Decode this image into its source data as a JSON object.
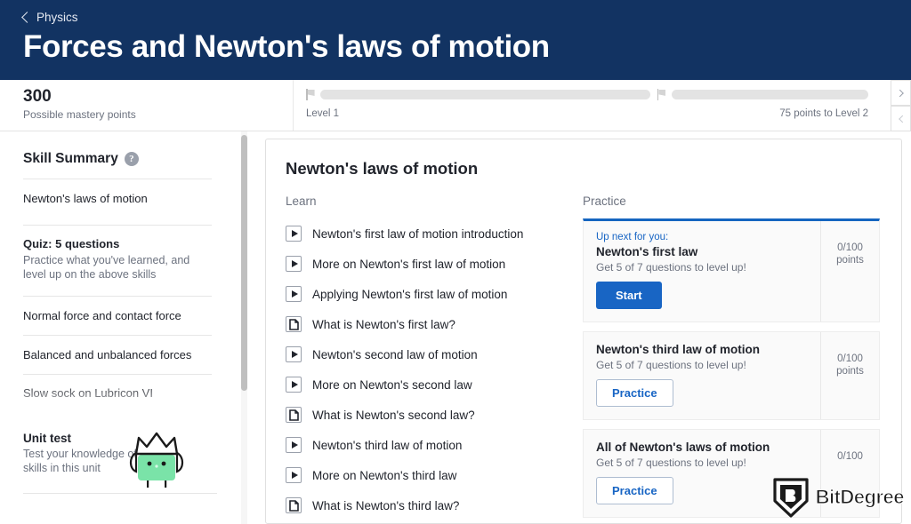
{
  "header": {
    "breadcrumb_label": "Physics",
    "back_icon": "chevron-left-icon",
    "title": "Forces and Newton's laws of motion",
    "bg_color": "#123362"
  },
  "mastery_bar": {
    "points": "300",
    "points_caption": "Possible mastery points",
    "level_label": "Level 1",
    "next_level_label": "75 points to Level 2",
    "flag_icon": "flag-icon",
    "next_icon": "chevron-right-icon",
    "prev_icon": "chevron-left-icon"
  },
  "sidebar": {
    "title": "Skill Summary",
    "help_icon": "question-mark-icon",
    "help_glyph": "?",
    "skill": {
      "name": "Newton's laws of motion",
      "mastery_icons": [
        "mastery-icon",
        "mastery-icon",
        "mastery-icon"
      ]
    },
    "quiz": {
      "title": "Quiz: 5 questions",
      "description": "Practice what you've learned, and level up on the above skills"
    },
    "items": [
      "Normal force and contact force",
      "Balanced and unbalanced forces",
      "Slow sock on Lubricon VI"
    ],
    "unit_test": {
      "title": "Unit test",
      "description": "Test your knowledge of all skills in this unit",
      "mascot_icon": "khan-mascot-crown-icon"
    }
  },
  "main": {
    "title": "Newton's laws of motion",
    "learn_heading": "Learn",
    "practice_heading": "Practice",
    "learn_items": [
      {
        "label": "Newton's first law of motion introduction",
        "type": "video",
        "icon": "play-icon"
      },
      {
        "label": "More on Newton's first law of motion",
        "type": "video",
        "icon": "play-icon"
      },
      {
        "label": "Applying Newton's first law of motion",
        "type": "video",
        "icon": "play-icon"
      },
      {
        "label": "What is Newton's first law?",
        "type": "article",
        "icon": "article-icon"
      },
      {
        "label": "Newton's second law of motion",
        "type": "video",
        "icon": "play-icon"
      },
      {
        "label": "More on Newton's second law",
        "type": "video",
        "icon": "play-icon"
      },
      {
        "label": "What is Newton's second law?",
        "type": "article",
        "icon": "article-icon"
      },
      {
        "label": "Newton's third law of motion",
        "type": "video",
        "icon": "play-icon"
      },
      {
        "label": "More on Newton's third law",
        "type": "video",
        "icon": "play-icon"
      },
      {
        "label": "What is Newton's third law?",
        "type": "article",
        "icon": "article-icon"
      }
    ],
    "practice_cards": [
      {
        "up_next_label": "Up next for you:",
        "title": "Newton's first law",
        "subtitle": "Get 5 of 7 questions to level up!",
        "button_label": "Start",
        "button_style": "primary",
        "points": "0/100",
        "points_unit": "points",
        "mastery_icon": "mastery-icon"
      },
      {
        "up_next_label": "",
        "title": "Newton's third law of motion",
        "subtitle": "Get 5 of 7 questions to level up!",
        "button_label": "Practice",
        "button_style": "outline",
        "points": "0/100",
        "points_unit": "points",
        "mastery_icon": "mastery-icon"
      },
      {
        "up_next_label": "",
        "title": "All of Newton's laws of motion",
        "subtitle": "Get 5 of 7 questions to level up!",
        "button_label": "Practice",
        "button_style": "outline",
        "points": "0/100",
        "points_unit": "",
        "mastery_icon": "mastery-icon"
      }
    ]
  },
  "watermark": {
    "text": "BitDegree",
    "logo_icon": "bitdegree-shield-icon"
  },
  "colors": {
    "brand_navy": "#123362",
    "accent_blue": "#1865c4",
    "mascot_green": "#7ae3a8"
  }
}
